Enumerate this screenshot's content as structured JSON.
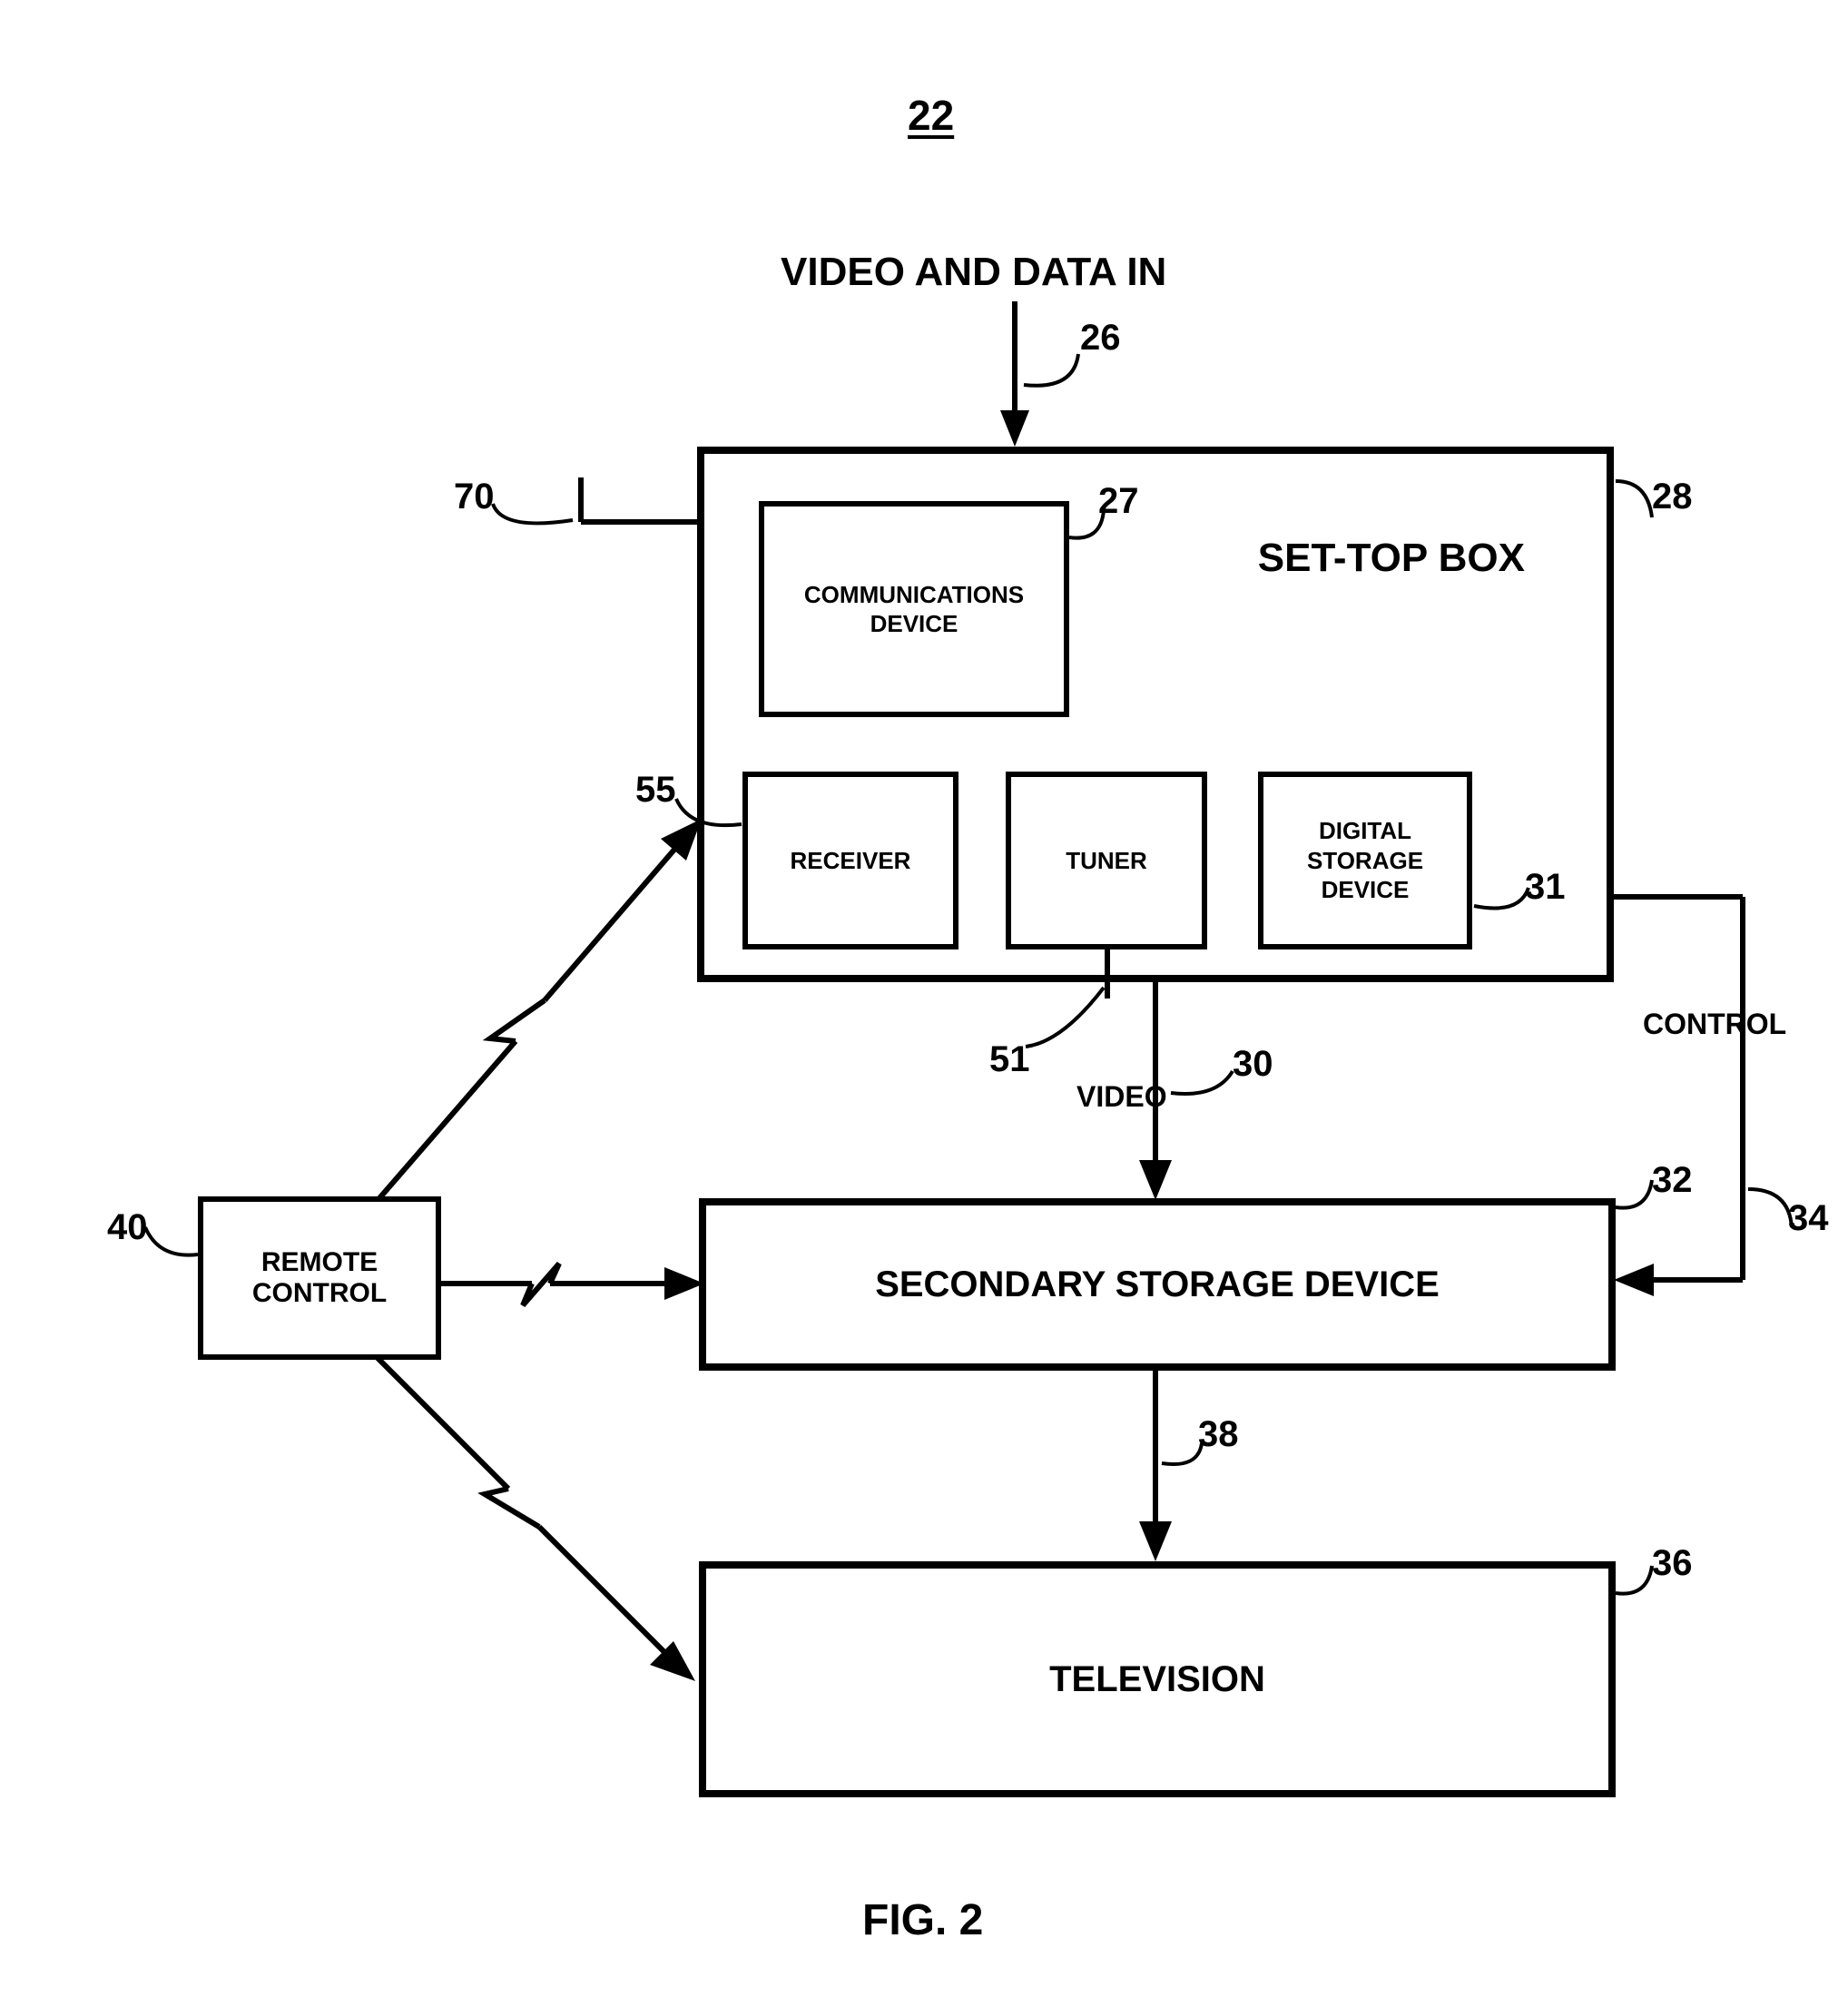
{
  "figure": {
    "number": "22",
    "caption": "FIG. 2",
    "top_label": "VIDEO AND DATA IN"
  },
  "refs": {
    "r22": "22",
    "r26": "26",
    "r27": "27",
    "r28": "28",
    "r30": "30",
    "r31": "31",
    "r32": "32",
    "r34": "34",
    "r36": "36",
    "r38": "38",
    "r40": "40",
    "r51": "51",
    "r55": "55",
    "r70": "70"
  },
  "boxes": {
    "settop_title": "SET-TOP BOX",
    "comm_device": "COMMUNICATIONS\nDEVICE",
    "receiver": "RECEIVER",
    "tuner": "TUNER",
    "digital_storage": "DIGITAL\nSTORAGE\nDEVICE",
    "secondary_storage": "SECONDARY STORAGE DEVICE",
    "television": "TELEVISION",
    "remote_control": "REMOTE\nCONTROL"
  },
  "line_labels": {
    "video": "VIDEO",
    "control": "CONTROL"
  }
}
